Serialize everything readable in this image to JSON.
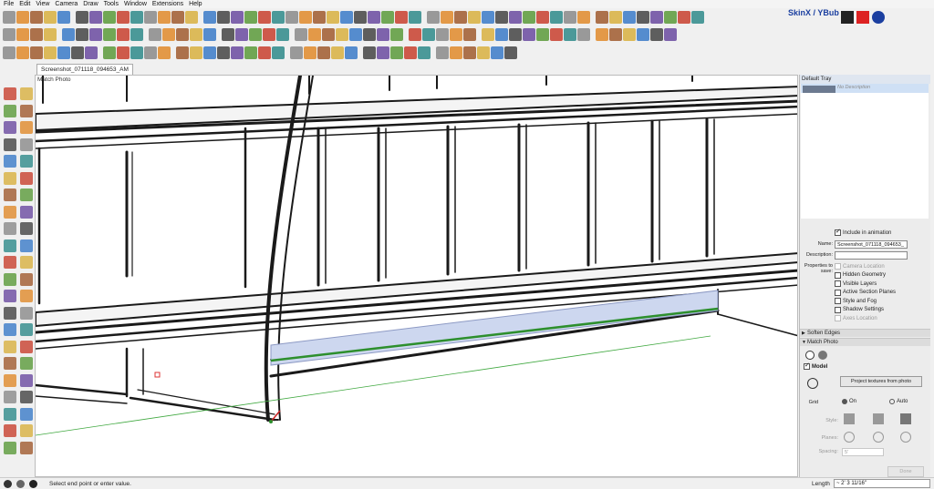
{
  "menu": [
    "File",
    "Edit",
    "View",
    "Camera",
    "Draw",
    "Tools",
    "Window",
    "Extensions",
    "Help"
  ],
  "brand": {
    "label": "SkinX / YBub"
  },
  "document_tab": "Screenshot_071118_094653_AM",
  "viewport": {
    "label": "Match Photo"
  },
  "tray": {
    "title": "Default Tray",
    "scene_description": "No Description",
    "include_in_animation": "Include in animation",
    "name_label": "Name:",
    "name_value": "Screenshot_071118_094653_",
    "description_label": "Description:",
    "description_value": "",
    "properties_label": "Properties to save:",
    "properties": [
      {
        "label": "Camera Location",
        "checked": false,
        "disabled": true
      },
      {
        "label": "Hidden Geometry",
        "checked": false,
        "disabled": false
      },
      {
        "label": "Visible Layers",
        "checked": false,
        "disabled": false
      },
      {
        "label": "Active Section Planes",
        "checked": false,
        "disabled": false
      },
      {
        "label": "Style and Fog",
        "checked": false,
        "disabled": false
      },
      {
        "label": "Shadow Settings",
        "checked": false,
        "disabled": false
      },
      {
        "label": "Axes Location",
        "checked": false,
        "disabled": true
      }
    ],
    "soften_edges": "Soften Edges",
    "match_photo": "Match Photo",
    "model_label": "Model",
    "project_button": "Project textures from photo",
    "grid_label": "Grid",
    "grid_on": "On",
    "grid_auto": "Auto",
    "style_label": "Style:",
    "planes_label": "Planes:",
    "spacing_label": "Spacing:",
    "spacing_value": "5'",
    "done_button": "Done"
  },
  "status": {
    "text": "Select end point or enter value.",
    "length_label": "Length",
    "length_value": "~ 2' 3 11/16\""
  },
  "colors": {
    "viewport_bg": "#ffffff",
    "tray_bg": "#ececec",
    "selection": "#cfe0f5",
    "green_edge": "#2d8f2d",
    "fill_blue": "#cdd7ef",
    "brand": "#1b3fa0"
  }
}
